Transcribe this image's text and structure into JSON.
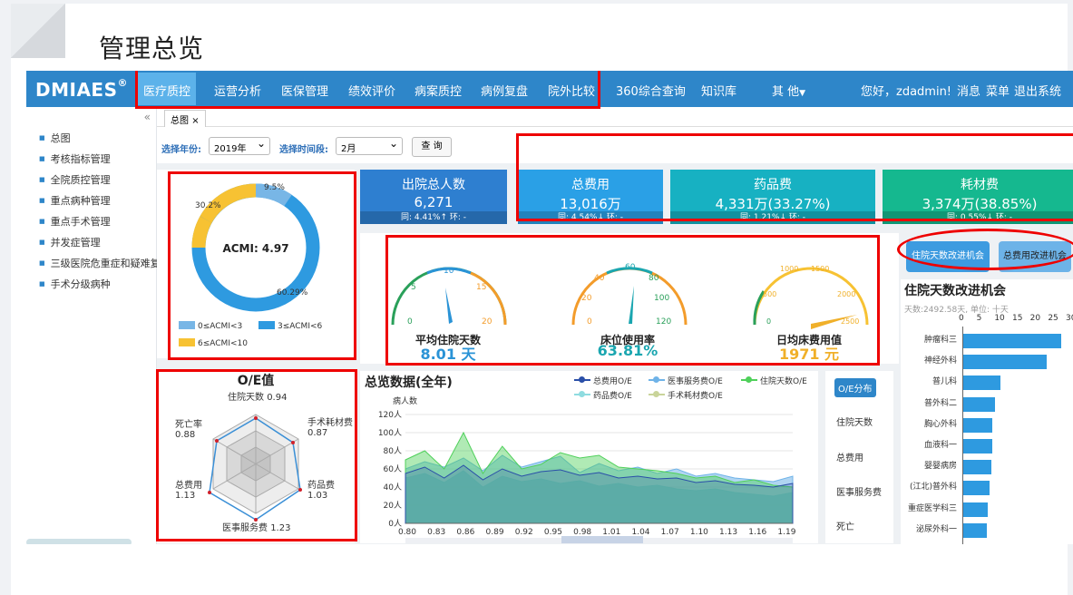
{
  "page_title": "管理总览",
  "nav": {
    "logo": "DMIAES",
    "logo_mark": "®",
    "items": [
      "医疗质控",
      "运营分析",
      "医保管理",
      "绩效评价",
      "病案质控",
      "病例复盘",
      "院外比较",
      "360综合查询",
      "知识库",
      "其 他"
    ],
    "greeting": "您好，zdadmin!",
    "links": [
      "消息",
      "菜单",
      "退出系统"
    ]
  },
  "sidebar": {
    "collapse_icon": "«",
    "items": [
      "总图",
      "考核指标管理",
      "全院质控管理",
      "重点病种管理",
      "重点手术管理",
      "并发症管理",
      "三级医院危重症和疑难复",
      "手术分级病种"
    ]
  },
  "tab": {
    "label": "总图",
    "close": "×"
  },
  "filter": {
    "year_label": "选择年份:",
    "year_value": "2019年",
    "period_label": "选择时间段:",
    "period_value": "2月",
    "query_label": "查 询"
  },
  "donut": {
    "center_label": "ACMI: 4.97",
    "labels": [
      "9.5%",
      "60.29%",
      "30.2%"
    ],
    "legend": [
      "0≤ACMI<3",
      "3≤ACMI<6",
      "6≤ACMI<10"
    ]
  },
  "kpis": [
    {
      "title": "出院总人数",
      "value": "6,271",
      "foot": "同: 4.41%↑  环: -",
      "color": "#2e7fd0"
    },
    {
      "title": "总费用",
      "value": "13,016万",
      "foot": "同: 4.54%↓  环: -",
      "color": "#2aa0e6"
    },
    {
      "title": "药品费",
      "value": "4,331万(33.27%)",
      "foot": "同: 1.21%↓  环: -",
      "color": "#17b1c2"
    },
    {
      "title": "耗材费",
      "value": "3,374万(38.85%)",
      "foot": "同: 0.55%↓  环: -",
      "color": "#15b88f"
    }
  ],
  "gauges": [
    {
      "label": "平均住院天数",
      "value": "8.01 天",
      "ticks": [
        "0",
        "5",
        "10",
        "15",
        "20"
      ],
      "value_color": "#2a93d6"
    },
    {
      "label": "床位使用率",
      "value": "63.81%",
      "ticks": [
        "0",
        "20",
        "40",
        "60",
        "80",
        "100",
        "120"
      ],
      "value_color": "#1aa6b0"
    },
    {
      "label": "日均床费用值",
      "value": "1971 元",
      "ticks": [
        "0",
        "500",
        "1000",
        "1500",
        "2000",
        "2500"
      ],
      "value_color": "#f0b02a"
    }
  ],
  "improve_buttons": [
    "住院天数改进机会",
    "总费用改进机会"
  ],
  "improve_panel": {
    "title": "住院天数改进机会",
    "subtitle": "天数:2492.58天, 单位: 十天",
    "ticks": [
      "0",
      "5",
      "10",
      "15",
      "20",
      "25",
      "30"
    ],
    "items": [
      {
        "name": "肿瘤科三",
        "value": 27.5
      },
      {
        "name": "神经外科",
        "value": 23.5
      },
      {
        "name": "普儿科",
        "value": 10.5
      },
      {
        "name": "普外科二",
        "value": 8.8
      },
      {
        "name": "胸心外科",
        "value": 8.2
      },
      {
        "name": "血液科一",
        "value": 8.2
      },
      {
        "name": "婴婴病房",
        "value": 8.0
      },
      {
        "name": "(江北)普外科",
        "value": 7.4
      },
      {
        "name": "重症医学科三",
        "value": 6.8
      },
      {
        "name": "泌尿外科一",
        "value": 6.5
      }
    ]
  },
  "oe_radar": {
    "title": "O/E值",
    "axes": [
      {
        "name": "住院天数",
        "value": "0.94"
      },
      {
        "name": "手术耗材费",
        "value": "0.87"
      },
      {
        "name": "药品费",
        "value": "1.03"
      },
      {
        "name": "医事服务费",
        "value": "1.23"
      },
      {
        "name": "总费用",
        "value": "1.13"
      },
      {
        "name": "死亡率",
        "value": "0.88"
      }
    ]
  },
  "overview": {
    "title": "总览数据(全年)",
    "ylabel": "病人数",
    "legend": [
      {
        "name": "总费用O/E",
        "color": "#2a4fa8"
      },
      {
        "name": "医事服务费O/E",
        "color": "#6fb3e8"
      },
      {
        "name": "住院天数O/E",
        "color": "#4fd05a"
      },
      {
        "name": "药品费O/E",
        "color": "#8fdce0"
      },
      {
        "name": "手术耗材费O/E",
        "color": "#c9d49a"
      }
    ],
    "side_buttons": [
      "O/E分布",
      "住院天数",
      "总费用",
      "医事服务费",
      "死亡"
    ]
  },
  "chart_data": {
    "type": "area",
    "xlabel": "",
    "ylabel": "病人数",
    "x_ticks": [
      "0.80",
      "0.83",
      "0.86",
      "0.89",
      "0.92",
      "0.95",
      "0.98",
      "1.01",
      "1.04",
      "1.07",
      "1.10",
      "1.13",
      "1.16",
      "1.19"
    ],
    "y_ticks": [
      "0人",
      "20人",
      "40人",
      "60人",
      "80人",
      "100人",
      "120人"
    ],
    "ylim": [
      0,
      120
    ],
    "x": [
      0.8,
      0.82,
      0.84,
      0.86,
      0.88,
      0.9,
      0.92,
      0.94,
      0.96,
      0.98,
      1.0,
      1.02,
      1.04,
      1.06,
      1.08,
      1.1,
      1.12,
      1.14,
      1.16,
      1.18,
      1.2
    ],
    "series": [
      {
        "name": "药品费O/E",
        "values": [
          50,
          55,
          45,
          58,
          40,
          52,
          46,
          49,
          44,
          47,
          41,
          44,
          40,
          42,
          38,
          36,
          38,
          34,
          32,
          30,
          34
        ]
      },
      {
        "name": "医事服务费O/E",
        "values": [
          60,
          68,
          62,
          72,
          58,
          75,
          62,
          68,
          74,
          56,
          66,
          58,
          62,
          55,
          60,
          52,
          55,
          50,
          48,
          46,
          52
        ]
      },
      {
        "name": "住院天数O/E",
        "values": [
          70,
          80,
          60,
          100,
          55,
          85,
          60,
          65,
          78,
          72,
          75,
          62,
          60,
          58,
          55,
          50,
          52,
          45,
          48,
          42,
          40
        ]
      },
      {
        "name": "总费用O/E",
        "values": [
          55,
          62,
          50,
          64,
          48,
          60,
          52,
          57,
          59,
          53,
          56,
          50,
          52,
          49,
          50,
          45,
          47,
          43,
          42,
          40,
          44
        ]
      }
    ]
  }
}
